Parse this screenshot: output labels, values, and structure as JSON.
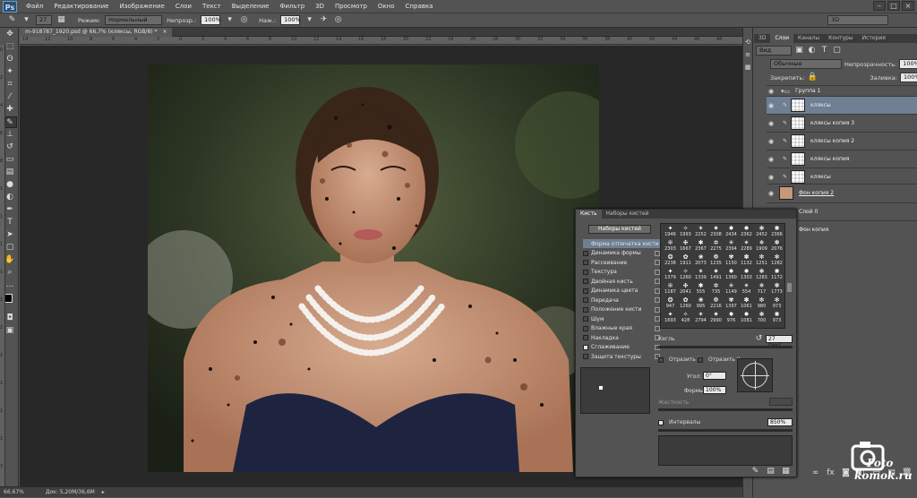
{
  "app": {
    "logo": "Ps"
  },
  "menu": [
    "Файл",
    "Редактирование",
    "Изображение",
    "Слои",
    "Текст",
    "Выделение",
    "Фильтр",
    "3D",
    "Просмотр",
    "Окно",
    "Справка"
  ],
  "options": {
    "size": "27",
    "mode_label": "Режим:",
    "mode_value": "Нормальный",
    "opacity_label": "Непрозр.:",
    "opacity_value": "100%",
    "flow_label": "Наж.:",
    "flow_value": "100%",
    "workspace": "3D"
  },
  "document": {
    "tab_title": "m-918787_1920.psd @ 66,7% (кляксы, RGB/8) *",
    "zoom": "66.67%",
    "doc_info": "Док: 5,20М/36,6М"
  },
  "ruler_h": [
    "14",
    "12",
    "10",
    "8",
    "6",
    "4",
    "2",
    "0",
    "2",
    "4",
    "6",
    "8",
    "10",
    "12",
    "14",
    "16",
    "18",
    "20",
    "22",
    "24",
    "26",
    "28",
    "30",
    "32",
    "34",
    "36",
    "38",
    "40",
    "42",
    "44",
    "46",
    "48"
  ],
  "ruler_v": [
    "0",
    "2",
    "4",
    "6",
    "8",
    "1",
    "1",
    "1",
    "1",
    "1",
    "2",
    "2",
    "2",
    "2",
    "2",
    "3"
  ],
  "layers_panel": {
    "tabs": [
      "3D",
      "Слои",
      "Каналы",
      "Контуры",
      "История"
    ],
    "kind_label": "Вид",
    "blend_mode": "Обычные",
    "opacity_label": "Непрозрачность:",
    "opacity_value": "100%",
    "lock_label": "Закрепить:",
    "fill_label": "Заливка:",
    "fill_value": "100%",
    "group_name": "Группа 1",
    "layers": [
      {
        "name": "кляксы",
        "selected": true
      },
      {
        "name": "кляксы копия 3",
        "selected": false
      },
      {
        "name": "кляксы копия 2",
        "selected": false
      },
      {
        "name": "кляксы копия",
        "selected": false
      },
      {
        "name": "кляксы",
        "selected": false
      }
    ],
    "layer_fon2": "Фон копия 2",
    "layer_sloy0": "Слой 0",
    "layer_fon": "Фон копия",
    "bottom_icons": [
      "link-icon",
      "fx-icon",
      "mask-icon",
      "adjustment-icon",
      "folder-icon",
      "new-layer-icon",
      "trash-icon"
    ]
  },
  "brush_panel": {
    "tabs": [
      "Кисть",
      "Наборы кистей"
    ],
    "presets_button": "Наборы кистей",
    "items": [
      {
        "label": "Форма отпечатка кисти",
        "checked": null,
        "active": true
      },
      {
        "label": "Динамика формы",
        "checked": false
      },
      {
        "label": "Рассеивание",
        "checked": false
      },
      {
        "label": "Текстура",
        "checked": false
      },
      {
        "label": "Двойная кисть",
        "checked": false
      },
      {
        "label": "Динамика цвета",
        "checked": false
      },
      {
        "label": "Передача",
        "checked": false
      },
      {
        "label": "Положение кисти",
        "checked": false
      },
      {
        "label": "Шум",
        "checked": false
      },
      {
        "label": "Влажные края",
        "checked": false
      },
      {
        "label": "Накладка",
        "checked": false
      },
      {
        "label": "Сглаживание",
        "checked": true
      },
      {
        "label": "Защита текстуры",
        "checked": false
      }
    ],
    "brushes": [
      "1946",
      "1993",
      "2252",
      "2308",
      "2434",
      "2362",
      "2452",
      "2366",
      "2303",
      "1667",
      "2367",
      "2275",
      "2394",
      "2289",
      "1909",
      "2076",
      "2238",
      "1911",
      "2073",
      "1235",
      "1150",
      "1132",
      "1251",
      "1282",
      "1379",
      "1260",
      "1339",
      "1491",
      "1360",
      "1303",
      "1283",
      "1172",
      "1187",
      "2041",
      "555",
      "735",
      "1149",
      "554",
      "717",
      "1773",
      "947",
      "1260",
      "995",
      "2216",
      "1397",
      "1061",
      "980",
      "973",
      "1693",
      "428",
      "2794",
      "2990",
      "976",
      "1081",
      "700",
      "973"
    ],
    "size_label": "Кегль",
    "size_value": "27 пикс.",
    "flip_x": "Отразить X",
    "flip_y": "Отразить Y",
    "angle_label": "Угол:",
    "angle_value": "0°",
    "roundness_label": "Формы:",
    "roundness_value": "100%",
    "hardness_label": "Жесткость",
    "spacing_label": "Интервалы",
    "spacing_value": "850%"
  },
  "watermark": {
    "line1": "Foto",
    "line2": "komok.ru"
  },
  "colors": {
    "accent_selected_layer": "#6f7f94",
    "panel": "#535353",
    "canvas_bg": "#282828"
  }
}
